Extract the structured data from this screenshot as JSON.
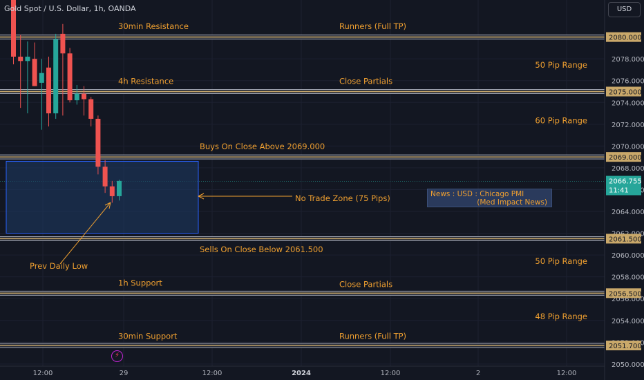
{
  "header": {
    "symbol_title": "Gold Spot / U.S. Dollar, 1h, OANDA",
    "currency_button": "USD"
  },
  "colors": {
    "background": "#131722",
    "bull": "#26a69a",
    "bear": "#ef5350",
    "level_band": "#c9a86a",
    "annotation_text": "#f0a030",
    "zone_fill": "#1e3a64",
    "zone_border": "#2962ff"
  },
  "chart_data": {
    "type": "candlestick",
    "title": "Gold Spot / U.S. Dollar, 1h, OANDA",
    "ylim": [
      2049.8,
      2083.4
    ],
    "y_ticks": [
      2050,
      2052,
      2054,
      2056,
      2058,
      2060,
      2062,
      2064,
      2066,
      2068,
      2070,
      2072,
      2074,
      2076,
      2078
    ],
    "x_tick_labels": [
      "12:00",
      "29",
      "12:00",
      "2024",
      "12:00",
      "2",
      "12:00"
    ],
    "x_tick_bold": [
      false,
      false,
      false,
      true,
      false,
      false,
      false
    ],
    "current_price": "2066.755",
    "countdown": "11:41",
    "levels": [
      {
        "price": 2080.0,
        "label": "2080.000"
      },
      {
        "price": 2075.0,
        "label": "2075.000"
      },
      {
        "price": 2069.0,
        "label": "2069.000"
      },
      {
        "price": 2061.5,
        "label": "2061.500"
      },
      {
        "price": 2056.5,
        "label": "2056.500"
      },
      {
        "price": 2051.7,
        "label": "2051.700"
      }
    ],
    "annotations": [
      {
        "text": "30min Resistance",
        "price": 2080.98,
        "align": "left",
        "slot": "left"
      },
      {
        "text": "Runners (Full TP)",
        "price": 2080.98,
        "align": "left",
        "slot": "mid"
      },
      {
        "text": "50 Pip Range",
        "price": 2077.45,
        "align": "right",
        "slot": "right"
      },
      {
        "text": "4h Resistance",
        "price": 2075.96,
        "align": "left",
        "slot": "left"
      },
      {
        "text": "Close Partials",
        "price": 2075.96,
        "align": "left",
        "slot": "mid"
      },
      {
        "text": "60 Pip Range",
        "price": 2072.35,
        "align": "right",
        "slot": "right"
      },
      {
        "text": "Buys On Close Above 2069.000",
        "price": 2069.95,
        "align": "left",
        "slot": "buy"
      },
      {
        "text": "No Trade Zone (75 Pips)",
        "price": 2065.2,
        "align": "left",
        "slot": "ntz"
      },
      {
        "text": "Sells On Close Below 2061.500",
        "price": 2060.5,
        "align": "left",
        "slot": "buy"
      },
      {
        "text": "50 Pip Range",
        "price": 2059.45,
        "align": "right",
        "slot": "right"
      },
      {
        "text": "Prev Daily Low",
        "price": 2059.0,
        "align": "left",
        "slot": "pdl"
      },
      {
        "text": "1h Support",
        "price": 2057.45,
        "align": "left",
        "slot": "left"
      },
      {
        "text": "Close Partials",
        "price": 2057.3,
        "align": "left",
        "slot": "mid"
      },
      {
        "text": "48 Pip Range",
        "price": 2054.35,
        "align": "right",
        "slot": "right"
      },
      {
        "text": "30min Support",
        "price": 2052.55,
        "align": "left",
        "slot": "left"
      },
      {
        "text": "Runners (Full TP)",
        "price": 2052.55,
        "align": "left",
        "slot": "mid"
      }
    ],
    "no_trade_zone": {
      "top": 2068.6,
      "bottom": 2062.0
    },
    "news": {
      "line1": "News : USD : Chicago PMI",
      "line2": "(Med Impact News)"
    },
    "candles": [
      {
        "o": 2083.4,
        "h": 2083.4,
        "l": 2077.5,
        "c": 2078.2
      },
      {
        "o": 2078.2,
        "h": 2080.2,
        "l": 2073.5,
        "c": 2077.8
      },
      {
        "o": 2077.8,
        "h": 2079.6,
        "l": 2073.0,
        "c": 2078.2
      },
      {
        "o": 2078.0,
        "h": 2079.5,
        "l": 2075.5,
        "c": 2075.5
      },
      {
        "o": 2075.8,
        "h": 2078.0,
        "l": 2071.5,
        "c": 2076.7
      },
      {
        "o": 2077.2,
        "h": 2078.2,
        "l": 2071.8,
        "c": 2073.0
      },
      {
        "o": 2073.0,
        "h": 2080.3,
        "l": 2072.5,
        "c": 2079.8
      },
      {
        "o": 2080.3,
        "h": 2081.2,
        "l": 2072.8,
        "c": 2078.5
      },
      {
        "o": 2078.5,
        "h": 2079.0,
        "l": 2074.0,
        "c": 2074.2
      },
      {
        "o": 2074.2,
        "h": 2075.6,
        "l": 2073.8,
        "c": 2074.8
      },
      {
        "o": 2074.8,
        "h": 2075.5,
        "l": 2072.8,
        "c": 2074.3
      },
      {
        "o": 2074.3,
        "h": 2074.5,
        "l": 2071.8,
        "c": 2072.5
      },
      {
        "o": 2072.5,
        "h": 2072.8,
        "l": 2067.4,
        "c": 2068.1
      },
      {
        "o": 2068.1,
        "h": 2068.7,
        "l": 2065.7,
        "c": 2066.3
      },
      {
        "o": 2066.3,
        "h": 2066.8,
        "l": 2064.8,
        "c": 2065.4
      },
      {
        "o": 2065.4,
        "h": 2066.9,
        "l": 2065.0,
        "c": 2066.8
      }
    ]
  }
}
